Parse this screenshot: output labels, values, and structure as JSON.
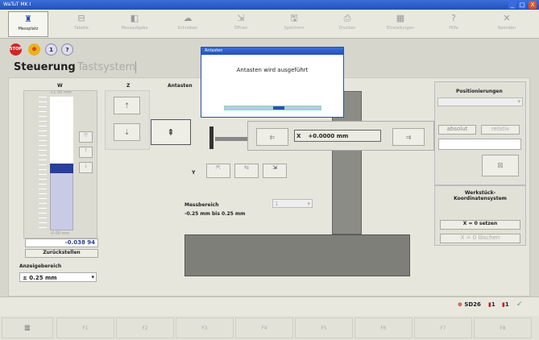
{
  "window": {
    "title": "WaTuT MK I",
    "min": "_",
    "max": "□",
    "close": "X"
  },
  "toolbar": [
    {
      "label": "Messplatz",
      "icon": "♜"
    },
    {
      "label": "Tabelle",
      "icon": "⊟"
    },
    {
      "label": "Messaufgabe",
      "icon": "◧"
    },
    {
      "label": "Schreiben",
      "icon": "☁"
    },
    {
      "label": "Öffnen",
      "icon": "⇲"
    },
    {
      "label": "Speichern",
      "icon": "🖫"
    },
    {
      "label": "Drucken",
      "icon": "⎙"
    },
    {
      "label": "Einstellungen",
      "icon": "▦"
    },
    {
      "label": "Hilfe",
      "icon": "?"
    },
    {
      "label": "Beenden",
      "icon": "✕"
    }
  ],
  "quick": {
    "stop": "STOP",
    "one": "1",
    "help": "?"
  },
  "tabs": {
    "steuerung": "Steuerung",
    "tastsystem": "Tastsystem"
  },
  "w": {
    "label": "W",
    "top": "+1.50 mm",
    "bottom": "-0.00 mm",
    "value": "-0.038 94",
    "reset": "Zurückstellen",
    "range_label": "Anzeigebereich",
    "range_value": "± 0.25 mm"
  },
  "z": {
    "label": "Z",
    "up": "⇡",
    "down": "⇣"
  },
  "antasten": {
    "label": "Antasten",
    "icon": "⇞"
  },
  "x": {
    "axis": "X",
    "value": "+0.0000 mm",
    "left": "⇇",
    "right": "⇉"
  },
  "y": {
    "label": "Y"
  },
  "mess": {
    "label": "Messbereich",
    "range": "-0.25 mm bis 0.25 mm",
    "select": "1"
  },
  "pos": {
    "title": "Positionierungen",
    "absolut": "absolut",
    "relativ": "relativ",
    "wk_title": "Werkstück-Koordinatensystem",
    "set": "X = 0 setzen",
    "clear": "X = 0 löschen"
  },
  "dialog": {
    "title": "Antasten",
    "message": "Antasten wird ausgeführt",
    "progress": 0.5
  },
  "status": {
    "sd": "SD26",
    "n1": "1",
    "n2": "1",
    "ok": "✓"
  },
  "fkeys": [
    "F1",
    "F2",
    "F3",
    "F4",
    "F5",
    "F6",
    "F7",
    "F8"
  ]
}
